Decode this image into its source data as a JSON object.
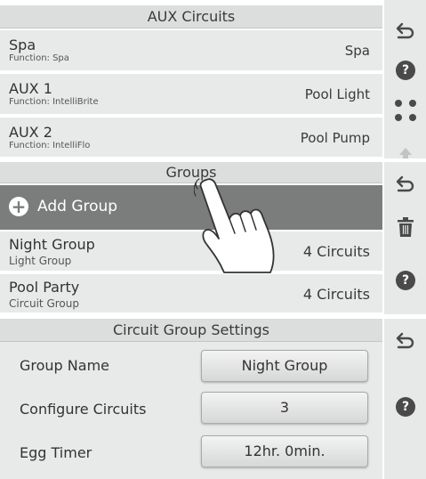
{
  "aux_panel": {
    "title": "AUX Circuits",
    "rows": [
      {
        "name": "Spa",
        "function": "Function: Spa",
        "value": "Spa"
      },
      {
        "name": "AUX 1",
        "function": "Function: IntelliBrite",
        "value": "Pool Light"
      },
      {
        "name": "AUX 2",
        "function": "Function: IntelliFlo",
        "value": "Pool Pump"
      }
    ],
    "side_icons": [
      "back-arrow-icon",
      "help-icon",
      "more-dots-icon",
      "scroll-up-arrow-icon"
    ]
  },
  "groups_panel": {
    "title": "Groups",
    "add_label": "Add Group",
    "rows": [
      {
        "name": "Night Group",
        "type": "Light Group",
        "value": "4 Circuits"
      },
      {
        "name": "Pool Party",
        "type": "Circuit Group",
        "value": "4 Circuits"
      }
    ],
    "side_icons": [
      "back-arrow-icon",
      "trash-icon",
      "help-icon"
    ],
    "overlay_icon": "pointing-hand-icon"
  },
  "settings_panel": {
    "title": "Circuit Group Settings",
    "fields": [
      {
        "label": "Group Name",
        "value": "Night Group"
      },
      {
        "label": "Configure Circuits",
        "value": "3"
      },
      {
        "label": "Egg Timer",
        "value": "12hr. 0min."
      }
    ],
    "side_icons": [
      "back-arrow-icon",
      "help-icon"
    ]
  },
  "colors": {
    "title_bar": "#dcdddd",
    "row_bg": "#e8e9e9",
    "selected_row": "#7b7d7d",
    "sidebar": "#e7e8e8",
    "icon": "#4a4a4a"
  }
}
